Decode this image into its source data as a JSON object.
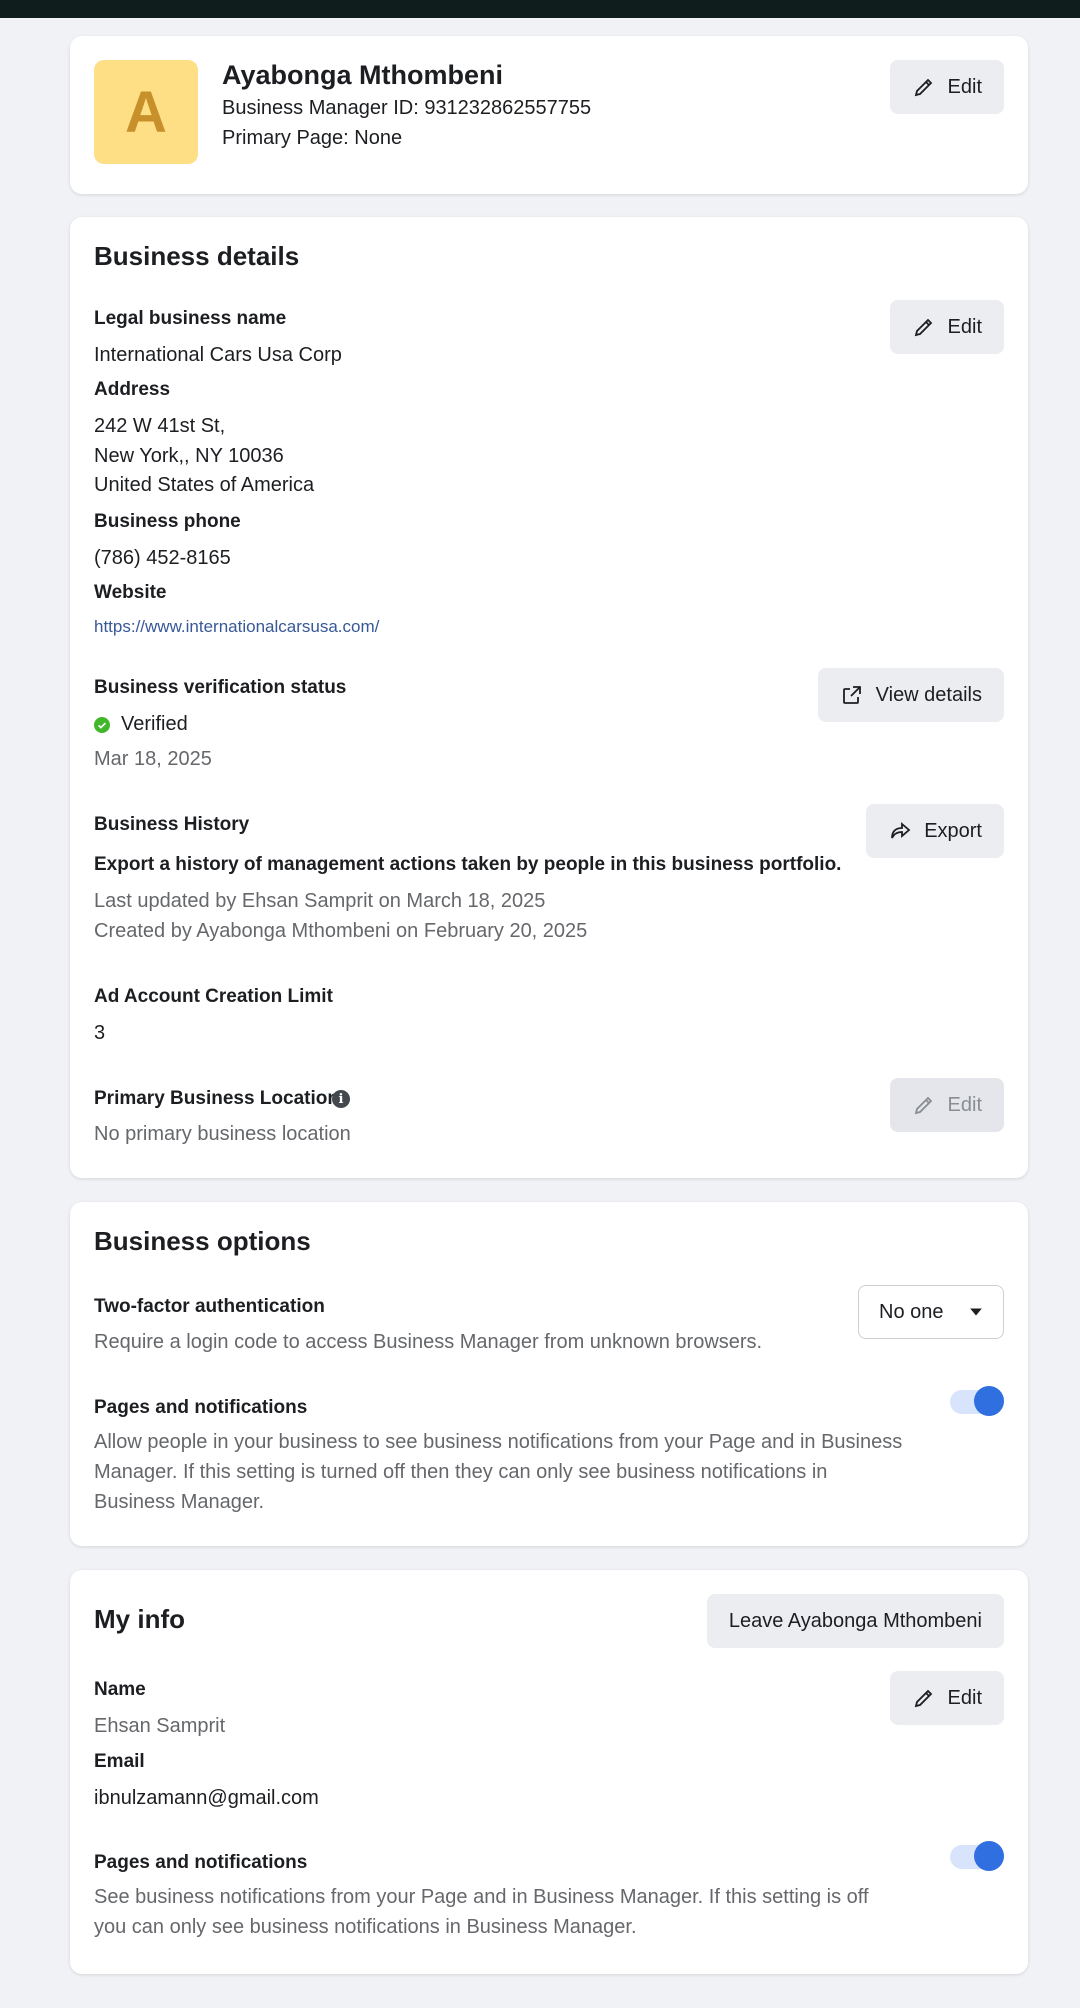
{
  "header": {
    "avatar_letter": "A",
    "name": "Ayabonga Mthombeni",
    "manager_id": "Business Manager ID: 931232862557755",
    "primary_page": "Primary Page: None",
    "edit_label": "Edit"
  },
  "business_details": {
    "title": "Business details",
    "edit_label": "Edit",
    "legal_name_label": "Legal business name",
    "legal_name": "International Cars Usa Corp",
    "address_label": "Address",
    "address_line1": "242 W 41st St,",
    "address_line2": "New York,, NY 10036",
    "address_line3": "United States of America",
    "phone_label": "Business phone",
    "phone": "(786) 452-8165",
    "website_label": "Website",
    "website": "https://www.internationalcarsusa.com/",
    "verification_label": "Business verification status",
    "verification_status": "Verified",
    "verification_date": "Mar 18, 2025",
    "view_details_label": "View details",
    "history_label": "Business History",
    "history_desc": "Export a history of management actions taken by people in this business portfolio.",
    "history_updated": "Last updated by Ehsan Samprit on March 18, 2025",
    "history_created": "Created by Ayabonga Mthombeni on February 20, 2025",
    "export_label": "Export",
    "ad_limit_label": "Ad Account Creation Limit",
    "ad_limit_value": "3",
    "primary_location_label": "Primary Business Location",
    "primary_location_value": "No primary business location",
    "primary_location_edit_label": "Edit"
  },
  "business_options": {
    "title": "Business options",
    "two_factor_label": "Two-factor authentication",
    "two_factor_desc": "Require a login code to access Business Manager from unknown browsers.",
    "two_factor_selected": "No one",
    "pages_notif_label": "Pages and notifications",
    "pages_notif_desc_1": "Allow people in your business to see business notifications from your Page and in Business",
    "pages_notif_desc_2": "Manager. If this setting is turned off then they can only see business notifications in",
    "pages_notif_desc_3": "Business Manager.",
    "pages_notif_on": true
  },
  "my_info": {
    "title": "My info",
    "leave_label": "Leave Ayabonga Mthombeni",
    "edit_label": "Edit",
    "name_label": "Name",
    "name": "Ehsan Samprit",
    "email_label": "Email",
    "email": "ibnulzamann@gmail.com",
    "pages_notif_label": "Pages and notifications",
    "pages_notif_desc_1": "See business notifications from your Page and in Business Manager. If this setting is off",
    "pages_notif_desc_2": "you can only see business notifications in Business Manager.",
    "pages_notif_on": true
  },
  "colors": {
    "accent": "#2f6fdf",
    "verified": "#42b72a",
    "avatar_bg": "#ffdf86",
    "avatar_fg": "#c8902a"
  }
}
